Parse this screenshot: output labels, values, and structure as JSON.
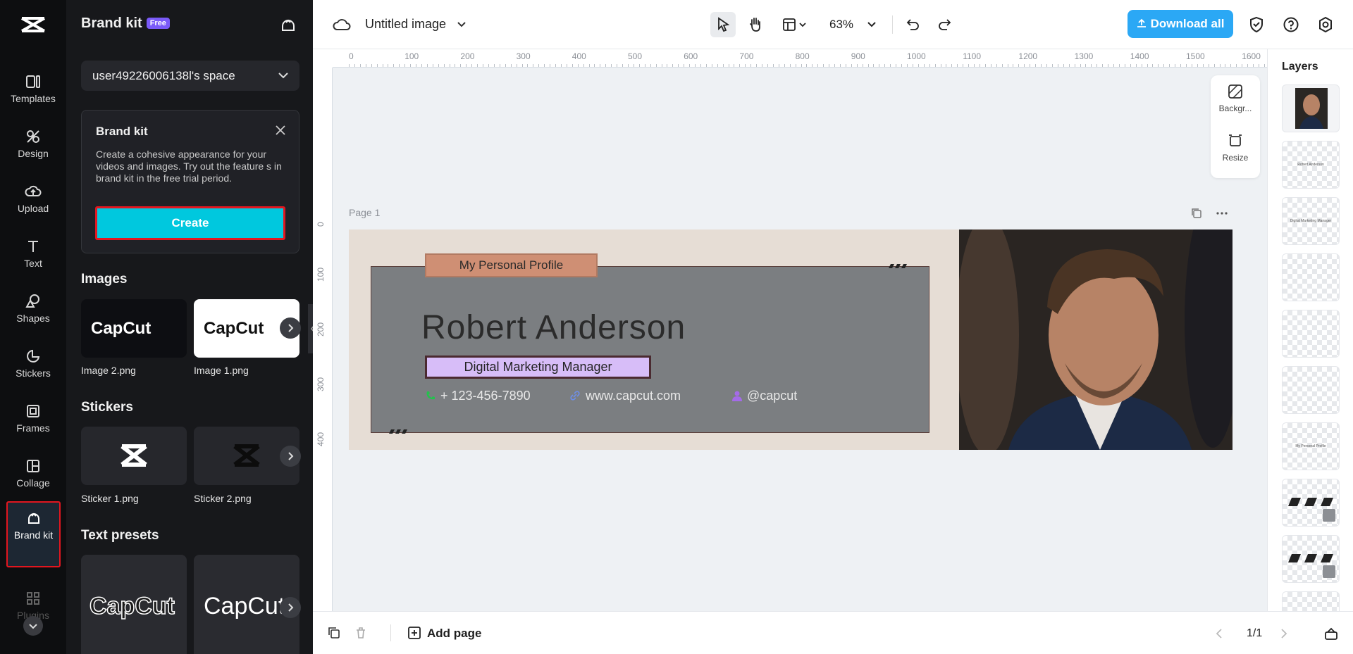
{
  "rail": {
    "items": [
      {
        "label": "Templates",
        "icon": "templates-icon"
      },
      {
        "label": "Design",
        "icon": "design-icon"
      },
      {
        "label": "Upload",
        "icon": "upload-icon"
      },
      {
        "label": "Text",
        "icon": "text-icon"
      },
      {
        "label": "Shapes",
        "icon": "shapes-icon"
      },
      {
        "label": "Stickers",
        "icon": "stickers-icon"
      },
      {
        "label": "Frames",
        "icon": "frames-icon"
      },
      {
        "label": "Collage",
        "icon": "collage-icon"
      },
      {
        "label": "Brand kit",
        "icon": "brand-kit-icon"
      },
      {
        "label": "Plugins",
        "icon": "plugins-icon"
      }
    ]
  },
  "panel": {
    "title": "Brand kit",
    "badge": "Free",
    "space_name": "user49226006138l's space",
    "card": {
      "title": "Brand kit",
      "description": "Create a cohesive appearance for your videos and images. Try out the feature s in brand kit in the free trial period.",
      "create_label": "Create"
    },
    "images_heading": "Images",
    "images": [
      {
        "caption": "Image 2.png",
        "logo_text": "CapCut"
      },
      {
        "caption": "Image 1.png",
        "logo_text": "CapCut"
      }
    ],
    "stickers_heading": "Stickers",
    "stickers": [
      {
        "caption": "Sticker 1.png"
      },
      {
        "caption": "Sticker 2.png"
      }
    ],
    "text_presets_heading": "Text presets",
    "text_presets": [
      {
        "text": "CapCut"
      },
      {
        "text": "CapCut"
      }
    ]
  },
  "topbar": {
    "doc_title": "Untitled image",
    "zoom": "63%",
    "download_label": "Download all"
  },
  "ruler": {
    "h_ticks": [
      "0",
      "100",
      "200",
      "300",
      "400",
      "500",
      "600",
      "700",
      "800",
      "900",
      "1000",
      "1100",
      "1200",
      "1300",
      "1400",
      "1500",
      "1600"
    ],
    "v_ticks": [
      "0",
      "100",
      "200",
      "300",
      "400"
    ]
  },
  "floating": {
    "background_label": "Backgr...",
    "resize_label": "Resize"
  },
  "canvas": {
    "page_label": "Page 1",
    "tag": "My Personal Profile",
    "name": "Robert Anderson",
    "role": "Digital Marketing Manager",
    "phone": "+ 123-456-7890",
    "website": "www.capcut.com",
    "handle": "@capcut"
  },
  "layers": {
    "heading": "Layers",
    "items": [
      {
        "label": ""
      },
      {
        "label": "Robert Anderson"
      },
      {
        "label": "Digital Marketing Manager"
      },
      {
        "label": ""
      },
      {
        "label": ""
      },
      {
        "label": ""
      },
      {
        "label": "My Personal Profile"
      },
      {
        "label": ""
      },
      {
        "label": ""
      }
    ]
  },
  "bottombar": {
    "add_page_label": "Add page",
    "page_count": "1/1"
  },
  "colors": {
    "accent": "#00c8de",
    "download": "#2ba8f5",
    "highlight": "#e2161f"
  }
}
